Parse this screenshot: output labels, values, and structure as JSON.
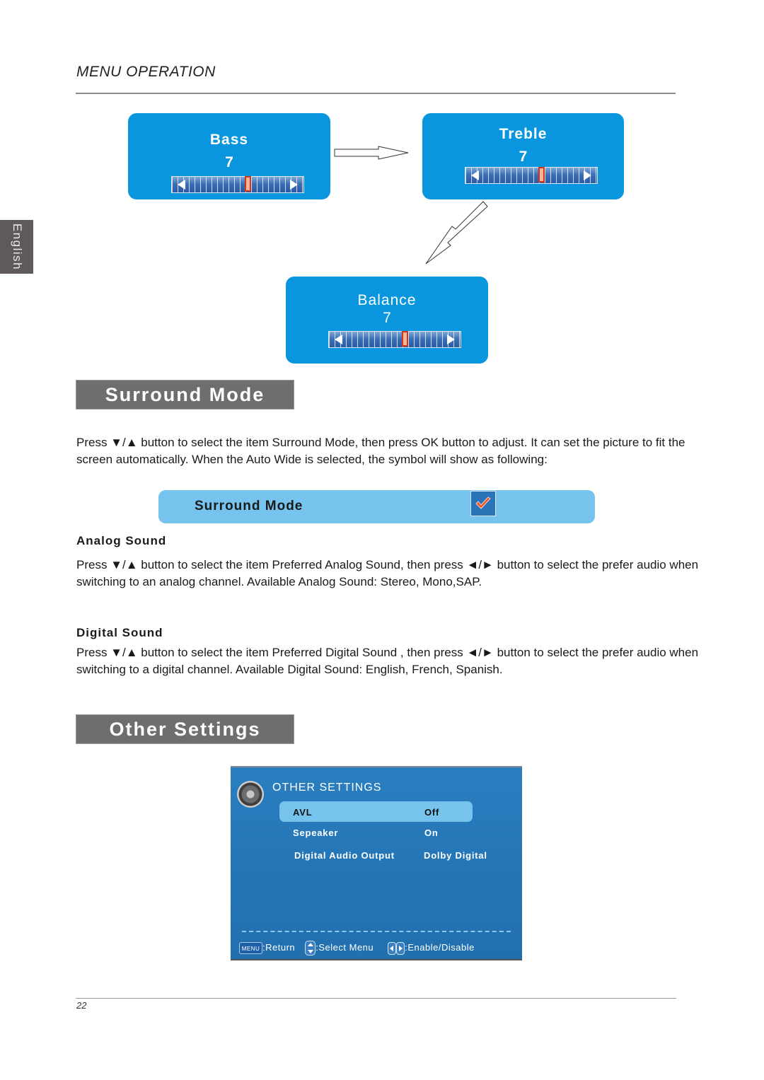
{
  "header": {
    "title": "MENU OPERATION"
  },
  "language_tab": {
    "label": "English"
  },
  "audio_osd": {
    "bass": {
      "label": "Bass",
      "value": "7",
      "level": 0.58
    },
    "treble": {
      "label": "Treble",
      "value": "7",
      "level": 0.58
    },
    "balance": {
      "label": "Balance",
      "value": "7",
      "level": 0.58
    }
  },
  "surround_mode": {
    "heading": "Surround Mode",
    "paragraph": "Press ▼/▲ button to select the item Surround Mode, then press OK button to adjust. It can set the picture to fit the screen automatically. When the Auto Wide is selected, the symbol will show as following:",
    "bar_label": "Surround Mode",
    "checked": true,
    "check_icon": "checkmark-icon"
  },
  "analog_sound": {
    "heading": "Analog Sound",
    "paragraph": "Press ▼/▲ button to select the item Preferred Analog Sound, then press ◄/► button to select the prefer audio when switching to an analog channel. Available Analog Sound: Stereo, Mono,SAP."
  },
  "digital_sound": {
    "heading": "Digital Sound",
    "paragraph": "Press ▼/▲ button to select the item Preferred Digital Sound , then press ◄/► button to select the prefer audio when switching to a digital channel. Available Digital Sound: English, French, Spanish."
  },
  "other_settings": {
    "heading": "Other Settings",
    "osd": {
      "title": "OTHER SETTINGS",
      "icon": "speaker-icon",
      "rows": [
        {
          "label": "AVL",
          "value": "Off",
          "selected": true
        },
        {
          "label": "Sepeaker",
          "value": "On",
          "selected": false
        },
        {
          "label": "Digital Audio Output",
          "value": "Dolby Digital",
          "selected": false
        }
      ],
      "footer": {
        "menu_key": "MENU",
        "return_label": ":Return",
        "select_label": ":Select Menu",
        "enable_label": ":Enable/Disable"
      }
    }
  },
  "page": {
    "number": "22"
  }
}
